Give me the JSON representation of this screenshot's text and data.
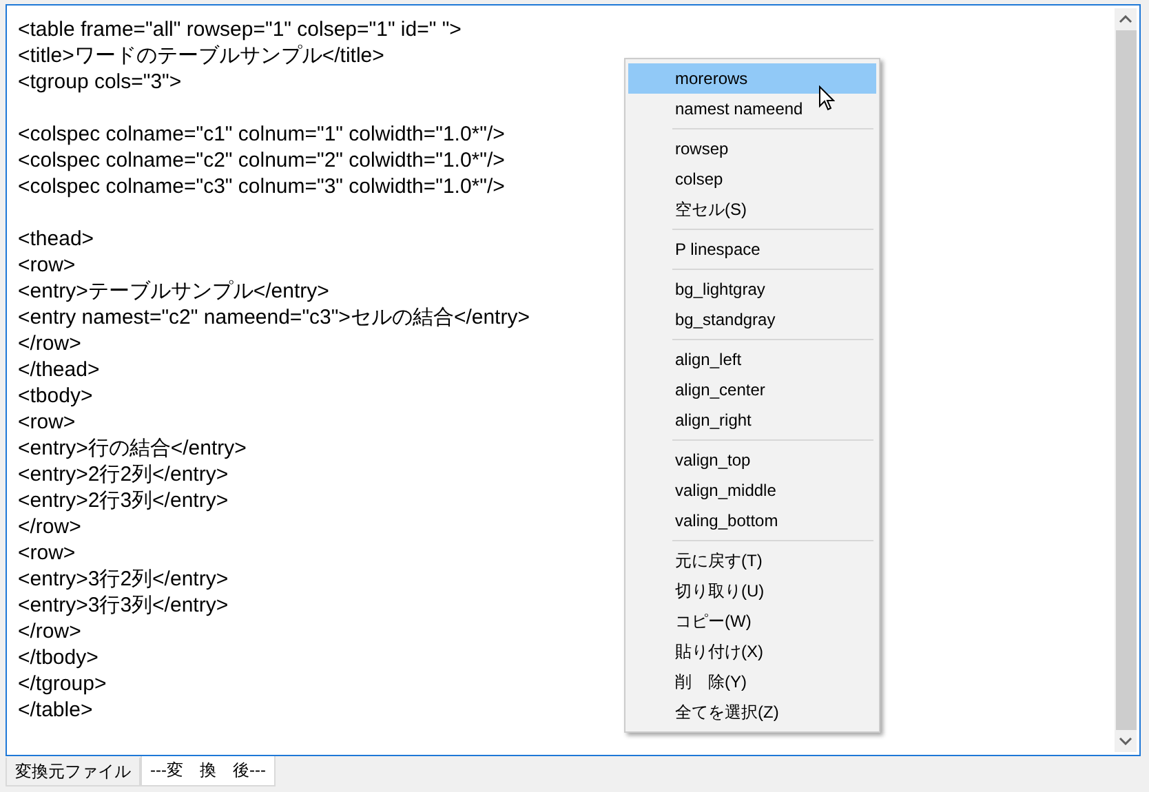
{
  "editor": {
    "blocks": [
      [
        "<table frame=\"all\" rowsep=\"1\" colsep=\"1\" id=\" \">",
        "<title>ワードのテーブルサンプル</title>",
        "<tgroup cols=\"3\">"
      ],
      [
        "<colspec colname=\"c1\" colnum=\"1\" colwidth=\"1.0*\"/>",
        "<colspec colname=\"c2\" colnum=\"2\" colwidth=\"1.0*\"/>",
        "<colspec colname=\"c3\" colnum=\"3\" colwidth=\"1.0*\"/>"
      ],
      [
        "<thead>",
        "<row>",
        "<entry>テーブルサンプル</entry>",
        "<entry namest=\"c2\" nameend=\"c3\">セルの結合</entry>",
        "</row>",
        "</thead>",
        "<tbody>",
        "<row>",
        "<entry>行の結合</entry>",
        "<entry>2行2列</entry>",
        "<entry>2行3列</entry>",
        "</row>",
        "<row>",
        "<entry>3行2列</entry>",
        "<entry>3行3列</entry>",
        "</row>",
        "</tbody>",
        "</tgroup>",
        "</table>"
      ]
    ]
  },
  "context_menu": {
    "items": [
      {
        "kind": "item",
        "label": "morerows",
        "selected": true
      },
      {
        "kind": "item",
        "label": "namest nameend",
        "selected": false
      },
      {
        "kind": "separator"
      },
      {
        "kind": "item",
        "label": "rowsep",
        "selected": false
      },
      {
        "kind": "item",
        "label": "colsep",
        "selected": false
      },
      {
        "kind": "item",
        "label": "空セル(S)",
        "selected": false
      },
      {
        "kind": "separator"
      },
      {
        "kind": "item",
        "label": "P linespace",
        "selected": false
      },
      {
        "kind": "separator"
      },
      {
        "kind": "item",
        "label": "bg_lightgray",
        "selected": false
      },
      {
        "kind": "item",
        "label": "bg_standgray",
        "selected": false
      },
      {
        "kind": "separator"
      },
      {
        "kind": "item",
        "label": "align_left",
        "selected": false
      },
      {
        "kind": "item",
        "label": "align_center",
        "selected": false
      },
      {
        "kind": "item",
        "label": "align_right",
        "selected": false
      },
      {
        "kind": "separator"
      },
      {
        "kind": "item",
        "label": "valign_top",
        "selected": false
      },
      {
        "kind": "item",
        "label": "valign_middle",
        "selected": false
      },
      {
        "kind": "item",
        "label": "valing_bottom",
        "selected": false
      },
      {
        "kind": "separator"
      },
      {
        "kind": "item",
        "label": "元に戻す(T)",
        "selected": false
      },
      {
        "kind": "item",
        "label": "切り取り(U)",
        "selected": false
      },
      {
        "kind": "item",
        "label": "コピー(W)",
        "selected": false
      },
      {
        "kind": "item",
        "label": "貼り付け(X)",
        "selected": false
      },
      {
        "kind": "item",
        "label": "削　除(Y)",
        "selected": false
      },
      {
        "kind": "item",
        "label": "全てを選択(Z)",
        "selected": false
      }
    ]
  },
  "tabs": [
    {
      "label": "変換元ファイル",
      "selected": false
    },
    {
      "label": "---変　換　後---",
      "selected": true
    }
  ]
}
